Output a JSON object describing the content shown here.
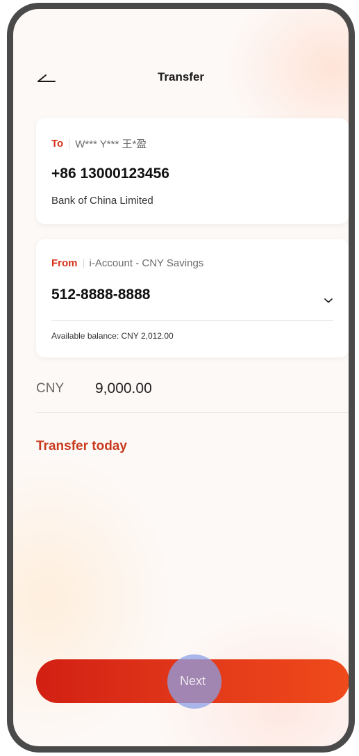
{
  "header": {
    "title": "Transfer",
    "back_icon": "back-arrow-icon"
  },
  "to_card": {
    "tag": "To",
    "recipient_name": "W*** Y*** 王*盈",
    "phone_number": "+86 13000123456",
    "bank_name": "Bank of China Limited"
  },
  "from_card": {
    "tag": "From",
    "account_type": "i-Account - CNY Savings",
    "account_number": "512-8888-8888",
    "balance_text": "Available balance: CNY 2,012.00",
    "dropdown_icon": "chevron-down-icon"
  },
  "amount": {
    "currency": "CNY",
    "value": "9,000.00"
  },
  "schedule": {
    "label": "Transfer today"
  },
  "actions": {
    "next_label": "Next"
  },
  "colors": {
    "accent": "#d4331a",
    "button_start": "#d21f13",
    "button_end": "#ef4a1b",
    "frame": "#4a4a4a"
  }
}
